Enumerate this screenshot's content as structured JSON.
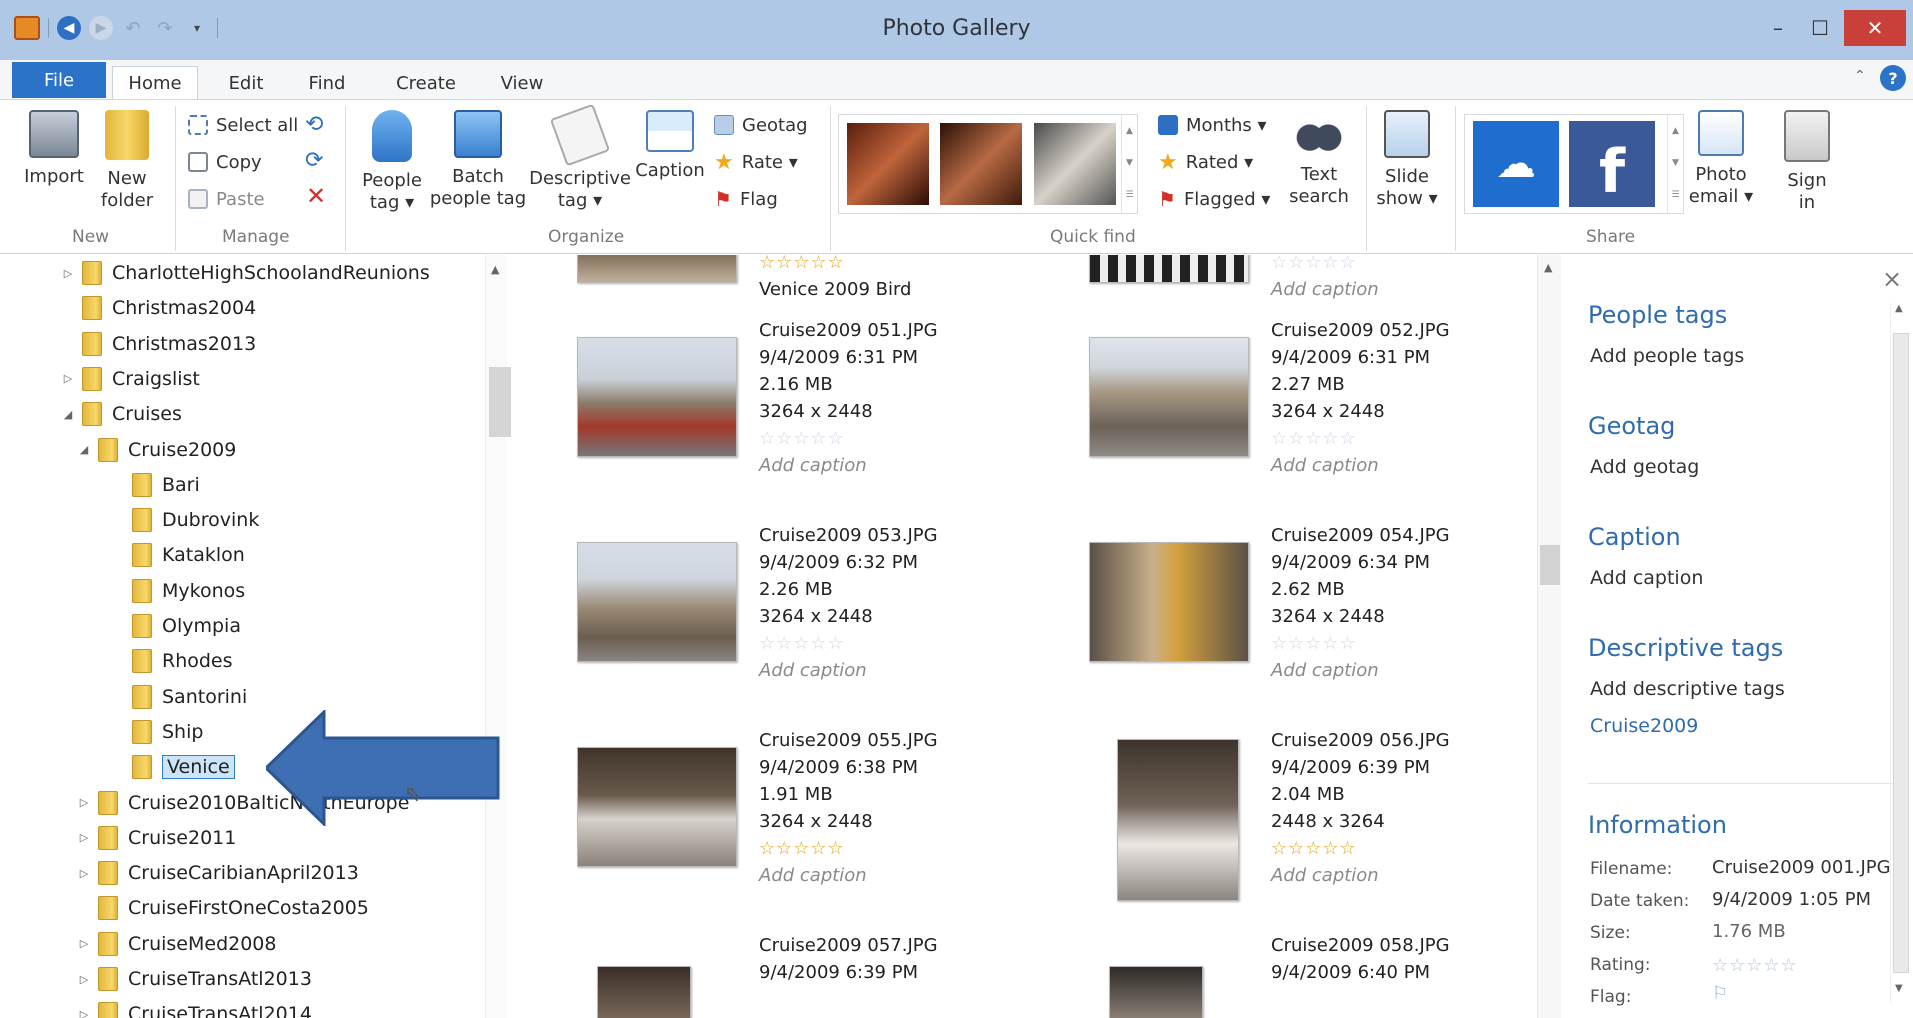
{
  "app": {
    "title": "Photo Gallery"
  },
  "menu": {
    "file": "File",
    "home": "Home",
    "edit": "Edit",
    "find": "Find",
    "create": "Create",
    "view": "View"
  },
  "ribbon": {
    "import": "Import",
    "new_folder_1": "New",
    "new_folder_2": "folder",
    "select_all": "Select all",
    "copy": "Copy",
    "paste": "Paste",
    "people_tag_1": "People",
    "people_tag_2": "tag ▾",
    "batch_1": "Batch",
    "batch_2": "people tag",
    "desc_1": "Descriptive",
    "desc_2": "tag ▾",
    "caption": "Caption",
    "geotag": "Geotag",
    "rate": "Rate ▾",
    "flag": "Flag",
    "months": "Months ▾",
    "rated": "Rated ▾",
    "flagged": "Flagged ▾",
    "text_1": "Text",
    "text_2": "search",
    "slide_1": "Slide",
    "slide_2": "show ▾",
    "photo_email_1": "Photo",
    "photo_email_2": "email ▾",
    "sign_1": "Sign",
    "sign_2": "in",
    "groups": {
      "new": "New",
      "manage": "Manage",
      "organize": "Organize",
      "quick_find": "Quick find",
      "share": "Share"
    },
    "accent": "#2b73c8"
  },
  "tree": [
    {
      "label": "CharlotteHighSchoolandReunions",
      "level": 0,
      "arrow": "▷"
    },
    {
      "label": "Christmas2004",
      "level": 0,
      "arrow": ""
    },
    {
      "label": "Christmas2013",
      "level": 0,
      "arrow": ""
    },
    {
      "label": "Craigslist",
      "level": 0,
      "arrow": "▷"
    },
    {
      "label": "Cruises",
      "level": 0,
      "arrow": "◢"
    },
    {
      "label": "Cruise2009",
      "level": 1,
      "arrow": "◢"
    },
    {
      "label": "Bari",
      "level": 2,
      "arrow": ""
    },
    {
      "label": "Dubrovink",
      "level": 2,
      "arrow": ""
    },
    {
      "label": "Kataklon",
      "level": 2,
      "arrow": ""
    },
    {
      "label": "Mykonos",
      "level": 2,
      "arrow": ""
    },
    {
      "label": "Olympia",
      "level": 2,
      "arrow": ""
    },
    {
      "label": "Rhodes",
      "level": 2,
      "arrow": ""
    },
    {
      "label": "Santorini",
      "level": 2,
      "arrow": ""
    },
    {
      "label": "Ship",
      "level": 2,
      "arrow": ""
    },
    {
      "label": "Venice",
      "level": 2,
      "arrow": "",
      "selected": true
    },
    {
      "label": "Cruise2010BalticNorthEurope",
      "level": 1,
      "arrow": "▷"
    },
    {
      "label": "Cruise2011",
      "level": 1,
      "arrow": "▷"
    },
    {
      "label": "CruiseCaribianApril2013",
      "level": 1,
      "arrow": "▷"
    },
    {
      "label": "CruiseFirstOneCosta2005",
      "level": 1,
      "arrow": ""
    },
    {
      "label": "CruiseMed2008",
      "level": 1,
      "arrow": "▷"
    },
    {
      "label": "CruiseTransAtl2013",
      "level": 1,
      "arrow": "▷"
    },
    {
      "label": "CruiseTransAtl2014",
      "level": 1,
      "arrow": "▷"
    }
  ],
  "gallery": {
    "top": [
      {
        "stars": "☆☆☆☆☆",
        "name": "Venice 2009 Bird"
      },
      {
        "stars": "☆☆☆☆☆",
        "name": "Add caption"
      }
    ],
    "items": [
      {
        "file": "Cruise2009 051.JPG",
        "date": "9/4/2009 6:31 PM",
        "size": "2.16 MB",
        "dims": "3264 x 2448",
        "stars": "☆☆☆☆☆",
        "caption": "Add caption"
      },
      {
        "file": "Cruise2009 052.JPG",
        "date": "9/4/2009 6:31 PM",
        "size": "2.27 MB",
        "dims": "3264 x 2448",
        "stars": "☆☆☆☆☆",
        "caption": "Add caption"
      },
      {
        "file": "Cruise2009 053.JPG",
        "date": "9/4/2009 6:32 PM",
        "size": "2.26 MB",
        "dims": "3264 x 2448",
        "stars": "☆☆☆☆☆",
        "caption": "Add caption"
      },
      {
        "file": "Cruise2009 054.JPG",
        "date": "9/4/2009 6:34 PM",
        "size": "2.62 MB",
        "dims": "3264 x 2448",
        "stars": "☆☆☆☆☆",
        "caption": "Add caption"
      },
      {
        "file": "Cruise2009 055.JPG",
        "date": "9/4/2009 6:38 PM",
        "size": "1.91 MB",
        "dims": "3264 x 2448",
        "stars": "☆☆☆☆☆",
        "caption": "Add caption"
      },
      {
        "file": "Cruise2009 056.JPG",
        "date": "9/4/2009 6:39 PM",
        "size": "2.04 MB",
        "dims": "2448 x 3264",
        "stars": "☆☆☆☆☆",
        "caption": "Add caption"
      },
      {
        "file": "Cruise2009 057.JPG",
        "date": "9/4/2009 6:39 PM"
      },
      {
        "file": "Cruise2009 058.JPG",
        "date": "9/4/2009 6:40 PM"
      }
    ]
  },
  "details": {
    "people_tags": "People tags",
    "add_people": "Add people tags",
    "geotag": "Geotag",
    "add_geotag": "Add geotag",
    "caption": "Caption",
    "add_caption": "Add caption",
    "desc_tags": "Descriptive tags",
    "add_desc": "Add descriptive tags",
    "tag_value": "Cruise2009",
    "information": "Information",
    "filename_label": "Filename:",
    "filename": "Cruise2009 001.JPG",
    "date_label": "Date taken:",
    "date": "9/4/2009  1:05 PM",
    "size_label": "Size:",
    "size": "1.76 MB",
    "rating_label": "Rating:",
    "rating": "☆☆☆☆☆",
    "flag_label": "Flag:",
    "flag": "⚐",
    "close": "×"
  }
}
